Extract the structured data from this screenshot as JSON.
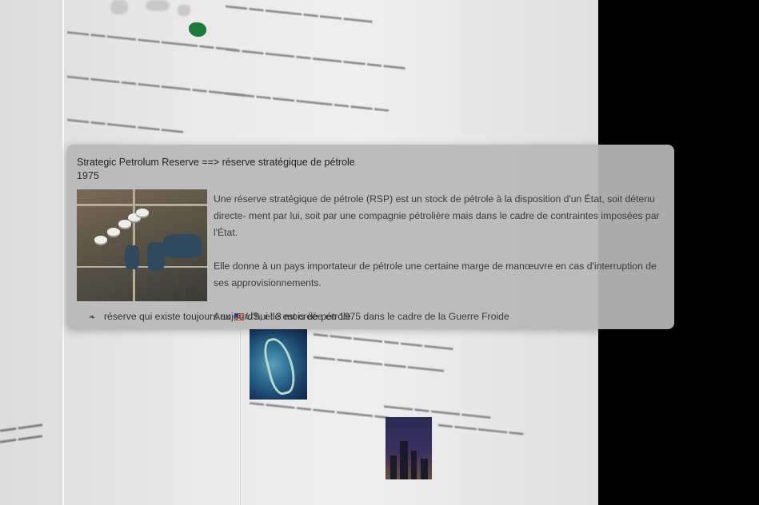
{
  "popup": {
    "title": "Strategic Petrolum Reserve ==> réserve stratégique de pétrole",
    "year": "1975",
    "paragraph1": "Une réserve stratégique de pétrole (RSP) est un stock de pétrole à la disposition d'un État, soit détenu directe- ment par lui, soit par une compagnie pétrolière mais dans le cadre de contraintes imposées par l'État.",
    "paragraph2": "Elle donne à un pays importateur de pétrole une certaine marge de manœuvre en cas d'interruption de ses approvisionnements.",
    "paragraph3_prefix": "Aux",
    "paragraph3_suffix": "US, elle est créée en 1975 dans le cadre de la Guerre Froide",
    "footnote": "réserve qui existe toujours aujourd'hui : 3 mois de pétrole.",
    "flag_icon": "us-flag-icon",
    "bullet_icon": "fleuron-icon"
  }
}
